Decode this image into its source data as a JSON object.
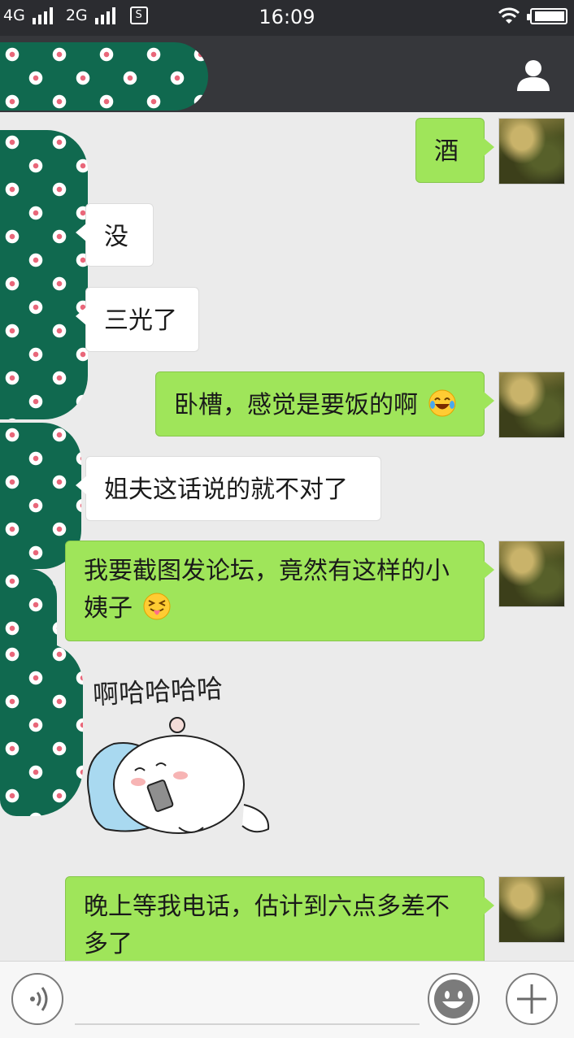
{
  "status_bar": {
    "network1": "4G",
    "network2": "2G",
    "sim_badge": "S",
    "time": "16:09"
  },
  "colors": {
    "outgoing_bubble": "#9fe55a",
    "incoming_bubble": "#ffffff",
    "chat_background": "#ebebeb",
    "header_background": "#36373b",
    "floral_green": "#10694f"
  },
  "messages": [
    {
      "direction": "out",
      "text": "酒"
    },
    {
      "direction": "in",
      "text": "没"
    },
    {
      "direction": "in",
      "text": "三光了"
    },
    {
      "direction": "out",
      "text": "卧槽，感觉是要饭的啊",
      "emoji": "laughing-tears-emoji"
    },
    {
      "direction": "in",
      "text": "姐夫这话说的就不对了"
    },
    {
      "direction": "out",
      "line1": "我要截图发论坛，竟然有这样的小",
      "line2": "姨子",
      "emoji": "tongue-out-emoji"
    },
    {
      "direction": "out",
      "line1": "晚上等我电话，估计到六点多差不",
      "line2": "多了"
    }
  ],
  "sticker": {
    "caption": "啊哈哈哈哈",
    "icon": "hamster-sticker"
  },
  "input": {
    "value": "",
    "placeholder": ""
  },
  "icons": {
    "profile": "person-icon",
    "voice": "voice-icon",
    "emoji": "smiley-icon",
    "more": "plus-icon"
  }
}
